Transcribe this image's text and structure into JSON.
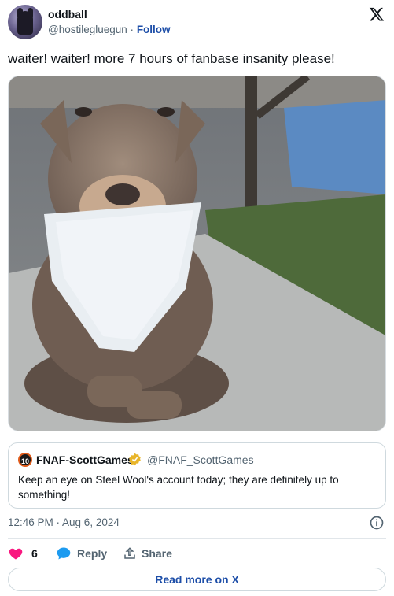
{
  "author": {
    "display_name": "oddball",
    "handle": "@hostilegluegun",
    "separator": "·",
    "follow_label": "Follow"
  },
  "tweet": {
    "text": "waiter! waiter! more 7 hours of fanbase insanity please!",
    "timestamp": "12:46 PM · Aug 6, 2024"
  },
  "quoted_tweet": {
    "display_name": "FNAF-ScottGames",
    "handle": "@FNAF_ScottGames",
    "logo_text": "10",
    "text": "Keep an eye on Steel Wool's account today; they are definitely up to something!"
  },
  "actions": {
    "like_count": "6",
    "reply_label": "Reply",
    "share_label": "Share"
  },
  "read_more_label": "Read more on X",
  "colors": {
    "like_red": "#f91880",
    "reply_blue": "#1d9bf0",
    "link_blue": "#1d4ea8",
    "verified_gold": "#e8b52a"
  },
  "icons": {
    "brand": "x-logo-icon",
    "verified": "gold-verified-badge-icon",
    "info": "info-icon",
    "like": "heart-icon",
    "reply": "speech-bubble-icon",
    "share": "share-upload-icon"
  }
}
